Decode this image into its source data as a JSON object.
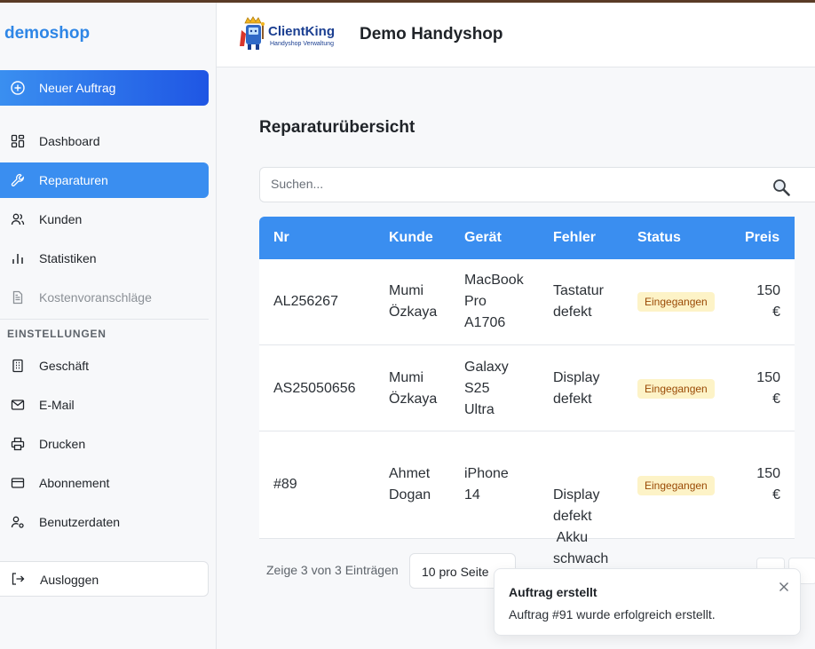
{
  "sidebar": {
    "brand": "demoshop",
    "new_order": "Neuer Auftrag",
    "items": [
      {
        "label": "Dashboard"
      },
      {
        "label": "Reparaturen"
      },
      {
        "label": "Kunden"
      },
      {
        "label": "Statistiken"
      },
      {
        "label": "Kostenvoranschläge"
      }
    ],
    "settings_label": "EINSTELLUNGEN",
    "settings_items": [
      {
        "label": "Geschäft"
      },
      {
        "label": "E-Mail"
      },
      {
        "label": "Drucken"
      },
      {
        "label": "Abonnement"
      },
      {
        "label": "Benutzerdaten"
      }
    ],
    "logout": "Ausloggen"
  },
  "header": {
    "logo_text": "ClientKing",
    "logo_sub": "Handyshop Verwaltung",
    "title": "Demo Handyshop"
  },
  "main": {
    "title": "Reparaturübersicht",
    "search_placeholder": "Suchen...",
    "columns": [
      "Nr",
      "Kunde",
      "Gerät",
      "Fehler",
      "Status",
      "Preis"
    ],
    "rows": [
      {
        "nr": "AL256267",
        "kunde": [
          "Mumi",
          "Özkaya"
        ],
        "geraet": [
          "MacBook",
          "Pro",
          "A1706"
        ],
        "fehler": [
          "Tastatur",
          "defekt"
        ],
        "status": "Eingegangen",
        "preis": [
          "150",
          "€"
        ]
      },
      {
        "nr": "AS25050656",
        "kunde": [
          "Mumi",
          "Özkaya"
        ],
        "geraet": [
          "Galaxy",
          "S25",
          "Ultra"
        ],
        "fehler": [
          "Display",
          "defekt"
        ],
        "status": "Eingegangen",
        "preis": [
          "150",
          "€"
        ]
      },
      {
        "nr": "#89",
        "kunde": [
          "Ahmet",
          "Dogan"
        ],
        "geraet": [
          "iPhone",
          "14"
        ],
        "fehler": [
          "Display",
          "defekt",
          " Akku",
          "schwach"
        ],
        "status": "Eingegangen",
        "preis": [
          "150",
          "€"
        ]
      }
    ],
    "footer_info": "Zeige 3 von 3 Einträgen",
    "per_page": "10 pro Seite"
  },
  "toast": {
    "title": "Auftrag erstellt",
    "message": "Auftrag #91 wurde erfolgreich erstellt."
  },
  "colors": {
    "accent": "#3a8ef0",
    "brand": "#2e86e6",
    "badge_bg": "#fdf3c7",
    "badge_text": "#9a4a05"
  }
}
